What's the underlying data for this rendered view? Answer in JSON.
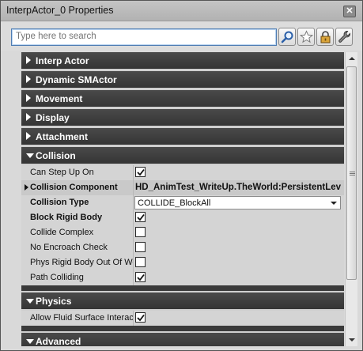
{
  "window": {
    "title": "InterpActor_0 Properties",
    "close_glyph": "✕"
  },
  "toolbar": {
    "search_placeholder": "Type here to search",
    "buttons": [
      "search-icon",
      "star-icon",
      "lock-icon",
      "wrench-icon"
    ]
  },
  "categories": {
    "interp_actor": "Interp Actor",
    "dynamic_smactor": "Dynamic SMActor",
    "movement": "Movement",
    "display": "Display",
    "attachment": "Attachment",
    "collision": "Collision",
    "physics": "Physics",
    "advanced": "Advanced"
  },
  "collision": {
    "can_step_up_on": {
      "label": "Can Step Up On",
      "checked": true
    },
    "collision_component": {
      "label": "Collision Component",
      "value": "HD_AnimTest_WriteUp.TheWorld:PersistentLev"
    },
    "collision_type": {
      "label": "Collision Type",
      "value": "COLLIDE_BlockAll"
    },
    "block_rigid_body": {
      "label": "Block Rigid Body",
      "checked": true
    },
    "collide_complex": {
      "label": "Collide Complex",
      "checked": false
    },
    "no_encroach_check": {
      "label": "No Encroach Check",
      "checked": false
    },
    "phys_rigid_body_out_of_world": {
      "label": "Phys Rigid Body Out Of World Check",
      "checked": false
    },
    "path_colliding": {
      "label": "Path Colliding",
      "checked": true
    }
  },
  "physics": {
    "allow_fluid_surface": {
      "label": "Allow Fluid Surface Interaction",
      "checked": true
    }
  },
  "colors": {
    "category_bg": "#3d3d3d",
    "row_bg": "#d4d4d4",
    "search_border": "#4f7db3"
  }
}
